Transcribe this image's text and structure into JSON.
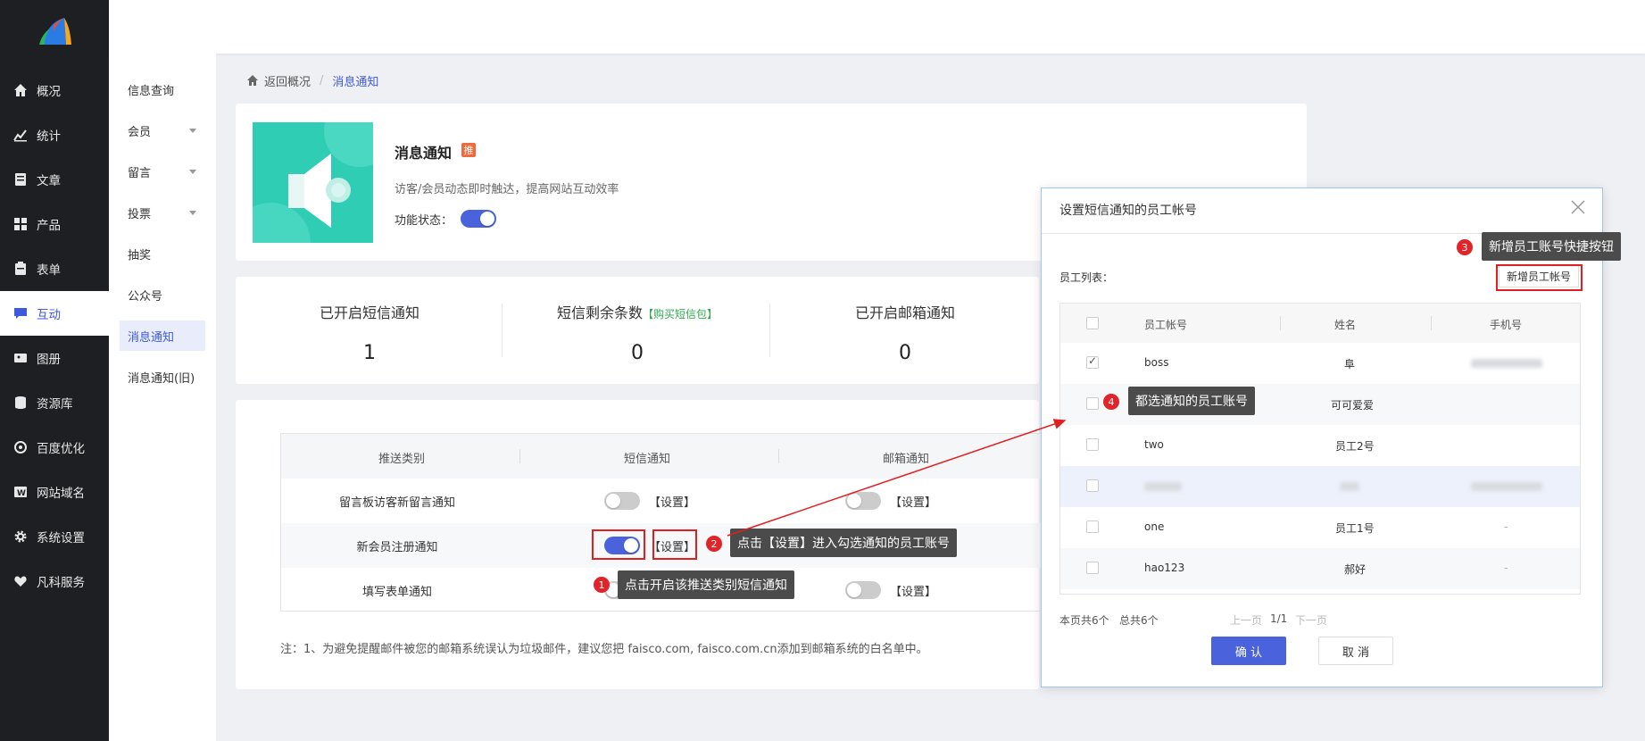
{
  "sidebar": {
    "items": [
      {
        "label": "概况",
        "icon": "home-icon"
      },
      {
        "label": "统计",
        "icon": "stats-icon"
      },
      {
        "label": "文章",
        "icon": "article-icon"
      },
      {
        "label": "产品",
        "icon": "product-icon"
      },
      {
        "label": "表单",
        "icon": "form-icon"
      },
      {
        "label": "互动",
        "icon": "chat-icon"
      },
      {
        "label": "图册",
        "icon": "album-icon"
      },
      {
        "label": "资源库",
        "icon": "database-icon"
      },
      {
        "label": "百度优化",
        "icon": "seo-icon"
      },
      {
        "label": "网站域名",
        "icon": "domain-icon"
      },
      {
        "label": "系统设置",
        "icon": "gear-icon"
      },
      {
        "label": "凡科服务",
        "icon": "heart-icon"
      }
    ],
    "active_index": 5,
    "accent": "#3f5ad8"
  },
  "subnav": {
    "items": [
      {
        "label": "信息查询"
      },
      {
        "label": "会员"
      },
      {
        "label": "留言"
      },
      {
        "label": "投票"
      },
      {
        "label": "抽奖"
      },
      {
        "label": "公众号"
      },
      {
        "label": "消息通知"
      },
      {
        "label": "消息通知(旧)"
      }
    ]
  },
  "breadcrumb": {
    "back": "返回概况",
    "sep": "/",
    "current": "消息通知"
  },
  "feature": {
    "title": "消息通知",
    "badge": "推",
    "desc": "访客/会员动态即时触达，提高网站互动效率",
    "status_label": "功能状态：",
    "status_on": true
  },
  "stats": [
    {
      "label": "已开启短信通知",
      "value": "1"
    },
    {
      "label": "短信剩余条数",
      "extra": "【购买短信包】",
      "value": "0"
    },
    {
      "label": "已开启邮箱通知",
      "value": "0"
    }
  ],
  "table": {
    "headers": [
      "推送类别",
      "短信通知",
      "邮箱通知"
    ],
    "setting_label": "【设置】",
    "rows": [
      {
        "name": "留言板访客新留言通知",
        "sms_on": false,
        "email_on": false
      },
      {
        "name": "新会员注册通知",
        "sms_on": true,
        "email_on": false
      },
      {
        "name": "填写表单通知",
        "sms_on": false,
        "email_on": false
      }
    ]
  },
  "note": "注：1、为避免提醒邮件被您的邮箱系统误认为垃圾邮件，建议您把 faisco.com, faisco.com.cn添加到邮箱系统的白名单中。",
  "annotations": [
    {
      "num": "1",
      "text": "点击开启该推送类别短信通知"
    },
    {
      "num": "2",
      "text": "点击【设置】进入勾选通知的员工账号"
    },
    {
      "num": "3",
      "text": "新增员工账号快捷按钮"
    },
    {
      "num": "4",
      "text": "都选通知的员工账号"
    }
  ],
  "modal": {
    "title": "设置短信通知的员工帐号",
    "list_label": "员工列表：",
    "add_button": "新增员工帐号",
    "headers": [
      "员工帐号",
      "姓名",
      "手机号"
    ],
    "rows": [
      {
        "account": "boss",
        "name": "阜",
        "phone": "",
        "checked": true
      },
      {
        "account": "",
        "name": "可可爱爱",
        "phone": "",
        "checked": false
      },
      {
        "account": "two",
        "name": "员工2号",
        "phone": "",
        "checked": false
      },
      {
        "account": "",
        "name": "",
        "phone": "",
        "checked": false
      },
      {
        "account": "one",
        "name": "员工1号",
        "phone": "-",
        "checked": false
      },
      {
        "account": "hao123",
        "name": "郝好",
        "phone": "-",
        "checked": false
      }
    ],
    "pager": {
      "page_count": "本页共6个",
      "total": "总共6个",
      "prev": "上一页",
      "page": "1/1",
      "next": "下一页"
    },
    "ok": "确 认",
    "cancel": "取 消"
  }
}
